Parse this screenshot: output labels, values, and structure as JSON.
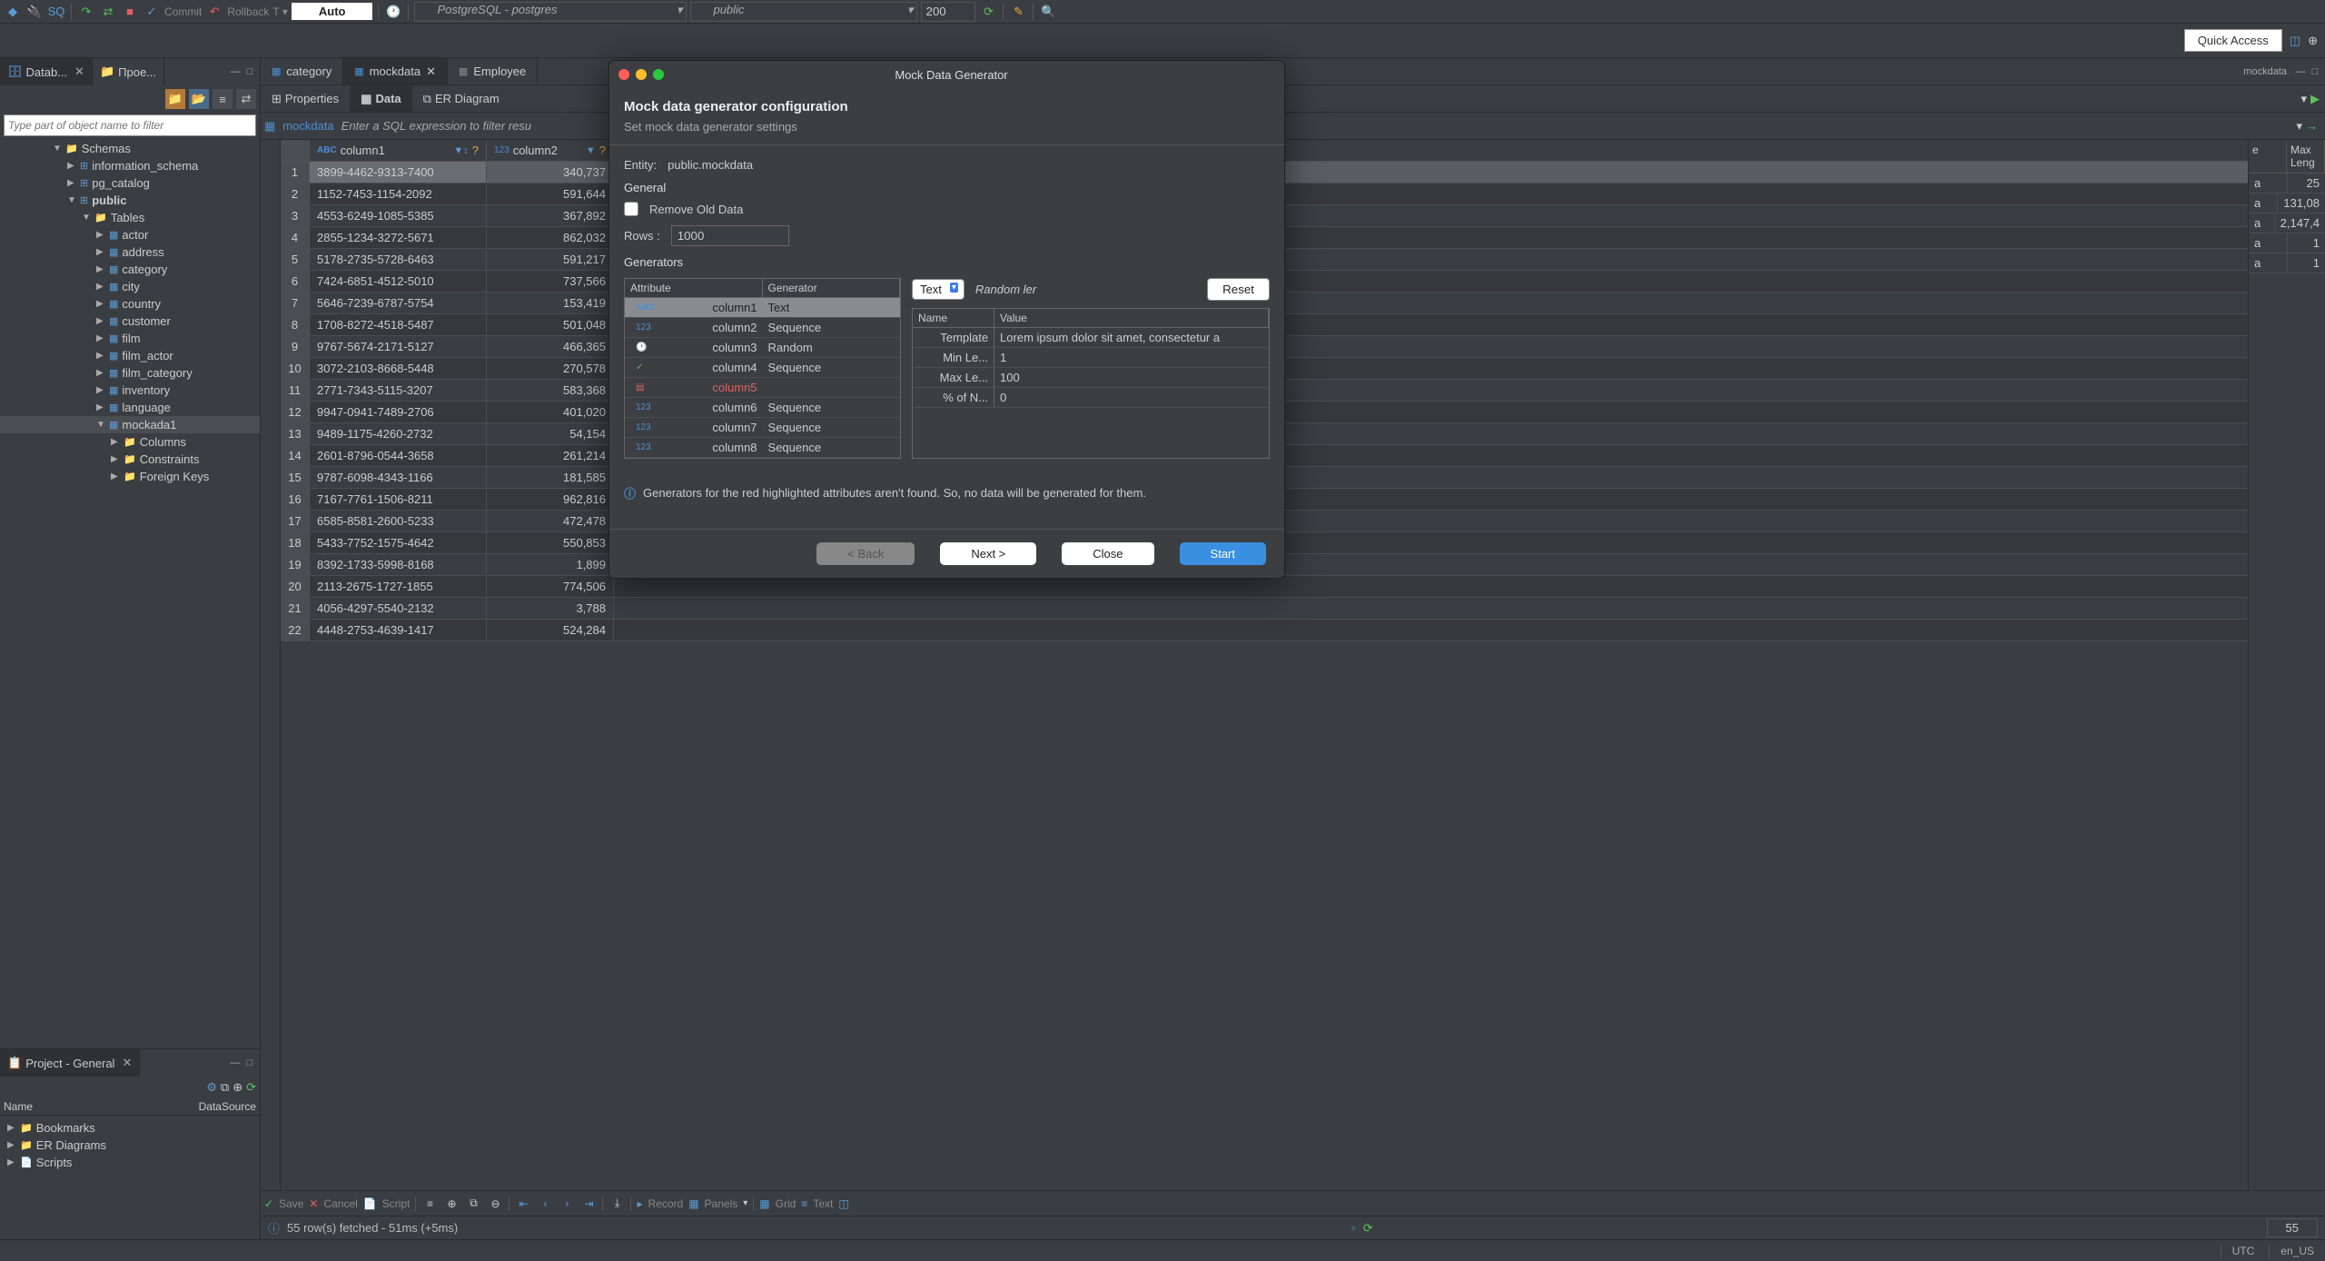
{
  "toolbar": {
    "commit": "Commit",
    "rollback": "Rollback",
    "auto": "Auto",
    "connection": "PostgreSQL - postgres",
    "schema": "public",
    "limit": "200"
  },
  "quick_access": "Quick Access",
  "left_tabs": {
    "database": "Datab...",
    "project": "Прое..."
  },
  "filter_placeholder": "Type part of object name to filter",
  "tree": {
    "schemas": "Schemas",
    "info_schema": "information_schema",
    "pg_catalog": "pg_catalog",
    "public": "public",
    "tables": "Tables",
    "items": [
      "actor",
      "address",
      "category",
      "city",
      "country",
      "customer",
      "film",
      "film_actor",
      "film_category",
      "inventory",
      "language",
      "mockada1"
    ],
    "sub": {
      "columns": "Columns",
      "constraints": "Constraints",
      "fkeys": "Foreign Keys"
    }
  },
  "project": {
    "title": "Project - General",
    "name": "Name",
    "ds": "DataSource",
    "items": [
      "Bookmarks",
      "ER Diagrams",
      "Scripts"
    ]
  },
  "editor": {
    "tabs": {
      "category": "category",
      "mockdata": "mockdata",
      "employee": "Employee"
    },
    "subtabs": {
      "properties": "Properties",
      "data": "Data",
      "er": "ER Diagram"
    },
    "table_name": "mockdata",
    "sql_hint": "Enter a SQL expression to filter resu",
    "col1": "column1",
    "col2": "column2",
    "rows": [
      {
        "n": "1",
        "c1": "3899-4462-9313-7400",
        "c2": "340,737"
      },
      {
        "n": "2",
        "c1": "1152-7453-1154-2092",
        "c2": "591,644"
      },
      {
        "n": "3",
        "c1": "4553-6249-1085-5385",
        "c2": "367,892"
      },
      {
        "n": "4",
        "c1": "2855-1234-3272-5671",
        "c2": "862,032"
      },
      {
        "n": "5",
        "c1": "5178-2735-5728-6463",
        "c2": "591,217"
      },
      {
        "n": "6",
        "c1": "7424-6851-4512-5010",
        "c2": "737,566"
      },
      {
        "n": "7",
        "c1": "5646-7239-6787-5754",
        "c2": "153,419"
      },
      {
        "n": "8",
        "c1": "1708-8272-4518-5487",
        "c2": "501,048"
      },
      {
        "n": "9",
        "c1": "9767-5674-2171-5127",
        "c2": "466,365"
      },
      {
        "n": "10",
        "c1": "3072-2103-8668-5448",
        "c2": "270,578"
      },
      {
        "n": "11",
        "c1": "2771-7343-5115-3207",
        "c2": "583,368"
      },
      {
        "n": "12",
        "c1": "9947-0941-7489-2706",
        "c2": "401,020"
      },
      {
        "n": "13",
        "c1": "9489-1175-4260-2732",
        "c2": "54,154"
      },
      {
        "n": "14",
        "c1": "2601-8796-0544-3658",
        "c2": "261,214"
      },
      {
        "n": "15",
        "c1": "9787-6098-4343-1166",
        "c2": "181,585"
      },
      {
        "n": "16",
        "c1": "7167-7761-1506-8211",
        "c2": "962,816"
      },
      {
        "n": "17",
        "c1": "6585-8581-2600-5233",
        "c2": "472,478"
      },
      {
        "n": "18",
        "c1": "5433-7752-1575-4642",
        "c2": "550,853"
      },
      {
        "n": "19",
        "c1": "8392-1733-5998-8168",
        "c2": "1,899"
      },
      {
        "n": "20",
        "c1": "2113-2675-1727-1855",
        "c2": "774,506"
      },
      {
        "n": "21",
        "c1": "4056-4297-5540-2132",
        "c2": "3,788"
      },
      {
        "n": "22",
        "c1": "4448-2753-4639-1417",
        "c2": "524,284"
      }
    ],
    "right_head": {
      "e": "e",
      "maxlen": "Max Leng"
    },
    "right_vals": [
      "a",
      "25",
      "a",
      "131,08",
      "a",
      "2,147,4",
      "a",
      "1",
      "a",
      "1"
    ]
  },
  "bottom": {
    "save": "Save",
    "cancel": "Cancel",
    "script": "Script",
    "record": "Record",
    "panels": "Panels",
    "grid": "Grid",
    "text": "Text"
  },
  "status": {
    "fetch": "55 row(s) fetched - 51ms (+5ms)",
    "count": "55"
  },
  "statusbar": {
    "utc": "UTC",
    "locale": "en_US"
  },
  "dialog": {
    "title": "Mock Data Generator",
    "header": "Mock data generator configuration",
    "sub": "Set mock data generator settings",
    "entity_lbl": "Entity:",
    "entity": "public.mockdata",
    "general": "General",
    "remove_old": "Remove Old Data",
    "rows_lbl": "Rows :",
    "rows_val": "1000",
    "generators": "Generators",
    "attr_h": "Attribute",
    "gen_h": "Generator",
    "gen_rows": [
      {
        "icon": "abc",
        "name": "column1",
        "gen": "Text",
        "sel": true
      },
      {
        "icon": "123",
        "name": "column2",
        "gen": "Sequence"
      },
      {
        "icon": "clock",
        "name": "column3",
        "gen": "Random"
      },
      {
        "icon": "check",
        "name": "column4",
        "gen": "Sequence"
      },
      {
        "icon": "doc",
        "name": "column5",
        "gen": "",
        "red": true
      },
      {
        "icon": "123",
        "name": "column6",
        "gen": "Sequence"
      },
      {
        "icon": "123",
        "name": "column7",
        "gen": "Sequence"
      },
      {
        "icon": "123",
        "name": "column8",
        "gen": "Sequence"
      }
    ],
    "type_sel": "Text",
    "gen_desc": "Random ler",
    "reset": "Reset",
    "name_h": "Name",
    "value_h": "Value",
    "props": [
      {
        "n": "Template",
        "v": "Lorem ipsum dolor sit amet, consectetur a"
      },
      {
        "n": "Min Le...",
        "v": "1"
      },
      {
        "n": "Max Le...",
        "v": "100"
      },
      {
        "n": "% of N...",
        "v": "0"
      }
    ],
    "warning": "Generators for the red highlighted attributes aren't found. So, no data will be generated for them.",
    "back": "< Back",
    "next": "Next >",
    "close": "Close",
    "start": "Start"
  }
}
